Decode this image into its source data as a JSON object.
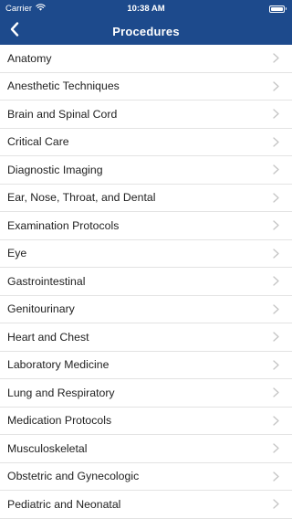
{
  "status_bar": {
    "carrier": "Carrier",
    "time": "10:38 AM"
  },
  "nav": {
    "title": "Procedures"
  },
  "colors": {
    "header": "#1d4a8c",
    "chevron": "#c4c4c4",
    "separator": "#e3e3e3"
  },
  "icons": {
    "back": "chevron-left-icon",
    "disclosure": "chevron-right-icon",
    "wifi": "wifi-icon",
    "battery": "battery-icon"
  },
  "items": [
    {
      "label": "Anatomy"
    },
    {
      "label": "Anesthetic Techniques"
    },
    {
      "label": "Brain and Spinal Cord"
    },
    {
      "label": "Critical Care"
    },
    {
      "label": "Diagnostic Imaging"
    },
    {
      "label": "Ear, Nose, Throat, and Dental"
    },
    {
      "label": "Examination Protocols"
    },
    {
      "label": "Eye"
    },
    {
      "label": "Gastrointestinal"
    },
    {
      "label": "Genitourinary"
    },
    {
      "label": "Heart and Chest"
    },
    {
      "label": "Laboratory Medicine"
    },
    {
      "label": "Lung and Respiratory"
    },
    {
      "label": "Medication Protocols"
    },
    {
      "label": "Musculoskeletal"
    },
    {
      "label": "Obstetric and Gynecologic"
    },
    {
      "label": "Pediatric and Neonatal"
    }
  ]
}
